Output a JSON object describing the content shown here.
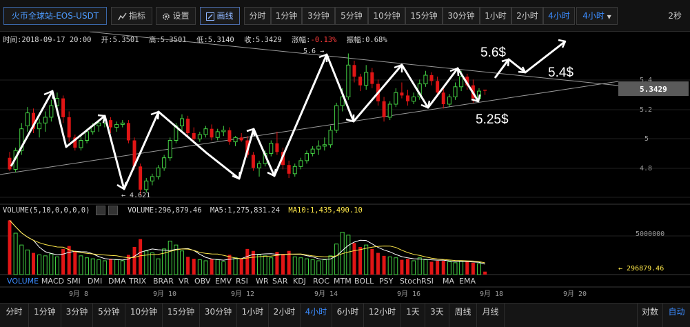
{
  "toolbar": {
    "symbol": "火币全球站-EOS-USDT",
    "indicators_label": "指标",
    "settings_label": "设置",
    "draw_label": "画线",
    "periods": [
      "分时",
      "1分钟",
      "3分钟",
      "5分钟",
      "10分钟",
      "15分钟",
      "30分钟",
      "1小时",
      "2小时",
      "4小时",
      "4小时"
    ],
    "active_period_index": 9,
    "dropdown_label": "4小时",
    "refresh": "2秒"
  },
  "info": {
    "time": "时间:2018-09-17 20:00",
    "open": "开:5.3501",
    "high": "高:5.3501",
    "low": "低:5.3140",
    "close": "收:5.3429",
    "change": "涨幅:",
    "change_value": "-0.13%",
    "amplitude": "振幅:0.68%"
  },
  "price_axis": {
    "ticks": [
      "5.4",
      "5.2",
      "5",
      "4.8"
    ],
    "current_price": "5.3429"
  },
  "volume_axis": {
    "tick": "5000000",
    "current": "← 296879.46"
  },
  "date_axis": {
    "ticks": [
      "9月 8",
      "9月 10",
      "9月 12",
      "9月 14",
      "9月 16",
      "9月 18",
      "9月 20"
    ]
  },
  "annotations": {
    "high_label": "5.6 →",
    "low_label": "← 4.621",
    "target_56": "5.6$",
    "target_54": "5.4$",
    "target_525": "5.25$"
  },
  "volume_legend": {
    "title": "VOLUME(5,10,0,0,0,0)",
    "volume": "VOLUME:296,879.46",
    "ma5": "MA5:1,275,831.24",
    "ma10": "MA10:1,435,490.10"
  },
  "indicators": [
    "VOLUME",
    "MACD",
    "SMI",
    "DMI",
    "DMA",
    "TRIX",
    "BRAR",
    "VR",
    "OBV",
    "EMV",
    "RSI",
    "WR",
    "SAR",
    "KDJ",
    "ROC",
    "MTM",
    "BOLL",
    "PSY",
    "StochRSI",
    "MA",
    "EMA"
  ],
  "bottom_periods": [
    "分时",
    "1分钟",
    "3分钟",
    "5分钟",
    "10分钟",
    "15分钟",
    "30分钟",
    "1小时",
    "2小时",
    "4小时",
    "6小时",
    "12小时",
    "1天",
    "3天",
    "周线",
    "月线"
  ],
  "bottom_active_index": 9,
  "bottom_right": [
    "对数",
    "自动"
  ],
  "colors": {
    "up": "#44d344",
    "down": "#e01515",
    "accent": "#3b8cff",
    "ma10": "#ffe94a"
  },
  "chart_data": {
    "type": "candlestick",
    "pair": "EOS-USDT",
    "interval": "4h",
    "ylim": [
      4.55,
      5.75
    ],
    "candles": [
      {
        "o": 4.88,
        "h": 4.92,
        "l": 4.79,
        "c": 4.8
      },
      {
        "o": 4.8,
        "h": 4.95,
        "l": 4.78,
        "c": 4.93
      },
      {
        "o": 4.93,
        "h": 5.12,
        "l": 4.9,
        "c": 5.08
      },
      {
        "o": 5.1,
        "h": 5.23,
        "l": 5.06,
        "c": 5.19
      },
      {
        "o": 5.19,
        "h": 5.22,
        "l": 5.05,
        "c": 5.08
      },
      {
        "o": 5.08,
        "h": 5.15,
        "l": 5.02,
        "c": 5.12
      },
      {
        "o": 5.12,
        "h": 5.2,
        "l": 5.06,
        "c": 5.16
      },
      {
        "o": 5.16,
        "h": 5.28,
        "l": 5.13,
        "c": 5.24
      },
      {
        "o": 5.24,
        "h": 5.33,
        "l": 5.2,
        "c": 5.29
      },
      {
        "o": 5.29,
        "h": 5.31,
        "l": 5.12,
        "c": 5.16
      },
      {
        "o": 5.16,
        "h": 5.2,
        "l": 4.99,
        "c": 5.02
      },
      {
        "o": 5.02,
        "h": 5.04,
        "l": 4.93,
        "c": 4.95
      },
      {
        "o": 4.95,
        "h": 5.03,
        "l": 4.93,
        "c": 5.0
      },
      {
        "o": 5.0,
        "h": 5.08,
        "l": 4.98,
        "c": 5.06
      },
      {
        "o": 5.06,
        "h": 5.12,
        "l": 5.04,
        "c": 5.1
      },
      {
        "o": 5.1,
        "h": 5.14,
        "l": 5.06,
        "c": 5.12
      },
      {
        "o": 5.12,
        "h": 5.17,
        "l": 5.09,
        "c": 5.14
      },
      {
        "o": 5.14,
        "h": 5.16,
        "l": 5.05,
        "c": 5.09
      },
      {
        "o": 5.09,
        "h": 5.13,
        "l": 5.06,
        "c": 5.11
      },
      {
        "o": 5.11,
        "h": 5.14,
        "l": 5.09,
        "c": 5.12
      },
      {
        "o": 5.12,
        "h": 5.14,
        "l": 4.98,
        "c": 5.0
      },
      {
        "o": 5.0,
        "h": 5.02,
        "l": 4.8,
        "c": 4.82
      },
      {
        "o": 4.82,
        "h": 4.84,
        "l": 4.621,
        "c": 4.66
      },
      {
        "o": 4.66,
        "h": 4.74,
        "l": 4.64,
        "c": 4.72
      },
      {
        "o": 4.72,
        "h": 4.77,
        "l": 4.69,
        "c": 4.75
      },
      {
        "o": 4.75,
        "h": 4.83,
        "l": 4.73,
        "c": 4.81
      },
      {
        "o": 4.81,
        "h": 4.9,
        "l": 4.79,
        "c": 4.88
      },
      {
        "o": 4.88,
        "h": 5.02,
        "l": 4.86,
        "c": 5.0
      },
      {
        "o": 5.0,
        "h": 5.12,
        "l": 4.98,
        "c": 5.1
      },
      {
        "o": 5.1,
        "h": 5.18,
        "l": 5.06,
        "c": 5.15
      },
      {
        "o": 5.15,
        "h": 5.17,
        "l": 5.03,
        "c": 5.05
      },
      {
        "o": 5.05,
        "h": 5.09,
        "l": 4.98,
        "c": 5.01
      },
      {
        "o": 5.01,
        "h": 5.06,
        "l": 4.99,
        "c": 5.04
      },
      {
        "o": 5.04,
        "h": 5.1,
        "l": 5.02,
        "c": 5.08
      },
      {
        "o": 5.08,
        "h": 5.11,
        "l": 5.0,
        "c": 5.02
      },
      {
        "o": 5.02,
        "h": 5.08,
        "l": 5.0,
        "c": 5.06
      },
      {
        "o": 5.06,
        "h": 5.1,
        "l": 5.03,
        "c": 5.07
      },
      {
        "o": 5.07,
        "h": 5.09,
        "l": 4.97,
        "c": 4.99
      },
      {
        "o": 4.99,
        "h": 5.03,
        "l": 4.96,
        "c": 5.02
      },
      {
        "o": 5.02,
        "h": 5.05,
        "l": 4.99,
        "c": 5.0
      },
      {
        "o": 5.0,
        "h": 5.03,
        "l": 4.88,
        "c": 4.9
      },
      {
        "o": 4.9,
        "h": 4.92,
        "l": 4.79,
        "c": 4.81
      },
      {
        "o": 4.81,
        "h": 4.86,
        "l": 4.75,
        "c": 4.84
      },
      {
        "o": 4.84,
        "h": 4.93,
        "l": 4.82,
        "c": 4.91
      },
      {
        "o": 4.91,
        "h": 5.0,
        "l": 4.89,
        "c": 4.98
      },
      {
        "o": 4.98,
        "h": 5.06,
        "l": 4.9,
        "c": 4.92
      },
      {
        "o": 4.92,
        "h": 4.95,
        "l": 4.8,
        "c": 4.83
      },
      {
        "o": 4.83,
        "h": 4.86,
        "l": 4.74,
        "c": 4.77
      },
      {
        "o": 4.77,
        "h": 4.84,
        "l": 4.75,
        "c": 4.82
      },
      {
        "o": 4.82,
        "h": 4.88,
        "l": 4.8,
        "c": 4.86
      },
      {
        "o": 4.86,
        "h": 4.93,
        "l": 4.84,
        "c": 4.91
      },
      {
        "o": 4.91,
        "h": 4.96,
        "l": 4.89,
        "c": 4.94
      },
      {
        "o": 4.94,
        "h": 5.0,
        "l": 4.9,
        "c": 4.96
      },
      {
        "o": 4.96,
        "h": 5.02,
        "l": 4.93,
        "c": 4.97
      },
      {
        "o": 4.97,
        "h": 5.1,
        "l": 4.95,
        "c": 5.07
      },
      {
        "o": 5.07,
        "h": 5.26,
        "l": 5.05,
        "c": 5.24
      },
      {
        "o": 5.24,
        "h": 5.36,
        "l": 5.2,
        "c": 5.3
      },
      {
        "o": 5.3,
        "h": 5.6,
        "l": 5.28,
        "c": 5.52
      },
      {
        "o": 5.52,
        "h": 5.55,
        "l": 5.4,
        "c": 5.44
      },
      {
        "o": 5.44,
        "h": 5.46,
        "l": 5.34,
        "c": 5.38
      },
      {
        "o": 5.38,
        "h": 5.52,
        "l": 5.35,
        "c": 5.47
      },
      {
        "o": 5.47,
        "h": 5.5,
        "l": 5.36,
        "c": 5.39
      },
      {
        "o": 5.39,
        "h": 5.42,
        "l": 5.24,
        "c": 5.27
      },
      {
        "o": 5.27,
        "h": 5.3,
        "l": 5.13,
        "c": 5.16
      },
      {
        "o": 5.16,
        "h": 5.27,
        "l": 5.14,
        "c": 5.25
      },
      {
        "o": 5.25,
        "h": 5.36,
        "l": 5.23,
        "c": 5.33
      },
      {
        "o": 5.33,
        "h": 5.4,
        "l": 5.29,
        "c": 5.31
      },
      {
        "o": 5.31,
        "h": 5.35,
        "l": 5.24,
        "c": 5.27
      },
      {
        "o": 5.27,
        "h": 5.33,
        "l": 5.25,
        "c": 5.3
      },
      {
        "o": 5.3,
        "h": 5.42,
        "l": 5.28,
        "c": 5.39
      },
      {
        "o": 5.39,
        "h": 5.48,
        "l": 5.37,
        "c": 5.45
      },
      {
        "o": 5.45,
        "h": 5.47,
        "l": 5.38,
        "c": 5.41
      },
      {
        "o": 5.41,
        "h": 5.44,
        "l": 5.3,
        "c": 5.33
      },
      {
        "o": 5.33,
        "h": 5.36,
        "l": 5.22,
        "c": 5.25
      },
      {
        "o": 5.25,
        "h": 5.32,
        "l": 5.23,
        "c": 5.3
      },
      {
        "o": 5.3,
        "h": 5.4,
        "l": 5.28,
        "c": 5.37
      },
      {
        "o": 5.37,
        "h": 5.48,
        "l": 5.34,
        "c": 5.44
      },
      {
        "o": 5.44,
        "h": 5.46,
        "l": 5.35,
        "c": 5.38
      },
      {
        "o": 5.38,
        "h": 5.42,
        "l": 5.26,
        "c": 5.29
      },
      {
        "o": 5.29,
        "h": 5.36,
        "l": 5.27,
        "c": 5.34
      },
      {
        "o": 5.3501,
        "h": 5.3501,
        "l": 5.314,
        "c": 5.3429
      }
    ],
    "volume": [
      5.5,
      4.2,
      3.0,
      2.5,
      2.2,
      2.0,
      1.9,
      2.1,
      1.8,
      2.6,
      2.9,
      2.4,
      1.9,
      1.7,
      1.6,
      1.5,
      1.4,
      1.6,
      1.5,
      1.4,
      2.0,
      2.8,
      3.6,
      2.4,
      2.2,
      1.6,
      2.6,
      3.4,
      3.0,
      2.4,
      1.8,
      1.6,
      1.5,
      1.4,
      1.6,
      1.5,
      1.3,
      2.0,
      1.7,
      1.6,
      2.6,
      2.4,
      2.0,
      1.9,
      1.7,
      2.3,
      2.1,
      2.4,
      1.8,
      1.7,
      1.6,
      1.5,
      1.4,
      1.5,
      1.9,
      3.1,
      4.3,
      4.0,
      3.2,
      2.8,
      3.0,
      2.6,
      2.2,
      1.9,
      1.8,
      1.7,
      1.5,
      1.6,
      1.4,
      1.7,
      1.5,
      1.3,
      1.4,
      1.4,
      1.3,
      1.2,
      1.4,
      1.3,
      1.2,
      1.1,
      0.3
    ],
    "volume_unit": 1000000,
    "volume_ylim": [
      0,
      6.3
    ]
  }
}
